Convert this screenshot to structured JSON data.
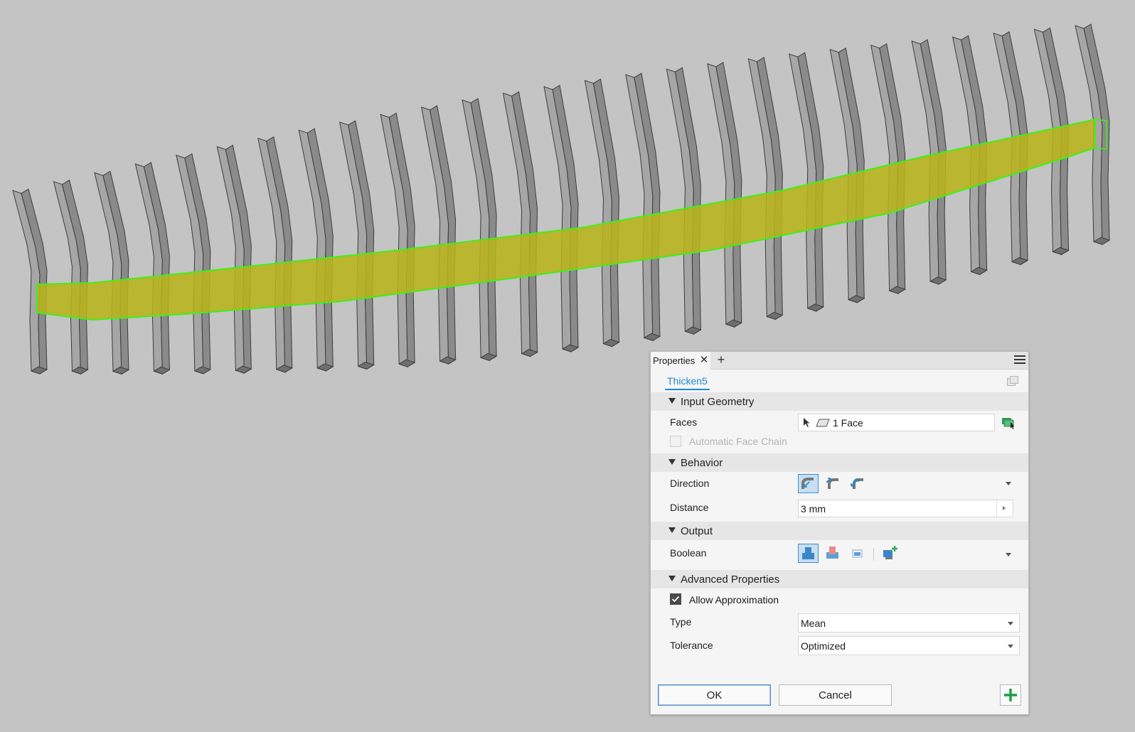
{
  "colors": {
    "canvas_bg": "#c4c4c4",
    "rib_fill": "#9a9a9a",
    "highlight_fill": "#b8b41a",
    "highlight_edge": "#3ff019",
    "accent": "#1e8ad1"
  },
  "panel": {
    "tab_label": "Properties",
    "feature_name": "Thicken5",
    "sections": {
      "input_geometry": "Input Geometry",
      "behavior": "Behavior",
      "output": "Output",
      "advanced": "Advanced Properties"
    },
    "faces": {
      "label": "Faces",
      "value": "1 Face"
    },
    "auto_face_chain": {
      "label": "Automatic Face Chain",
      "checked": false,
      "enabled": false
    },
    "direction": {
      "label": "Direction",
      "selected": "direction-1"
    },
    "distance": {
      "label": "Distance",
      "value": "3 mm"
    },
    "boolean": {
      "label": "Boolean",
      "selected": "join"
    },
    "allow_approximation": {
      "label": "Allow Approximation",
      "checked": true
    },
    "type": {
      "label": "Type",
      "value": "Mean"
    },
    "tolerance": {
      "label": "Tolerance",
      "value": "Optimized"
    },
    "ok_label": "OK",
    "cancel_label": "Cancel"
  }
}
